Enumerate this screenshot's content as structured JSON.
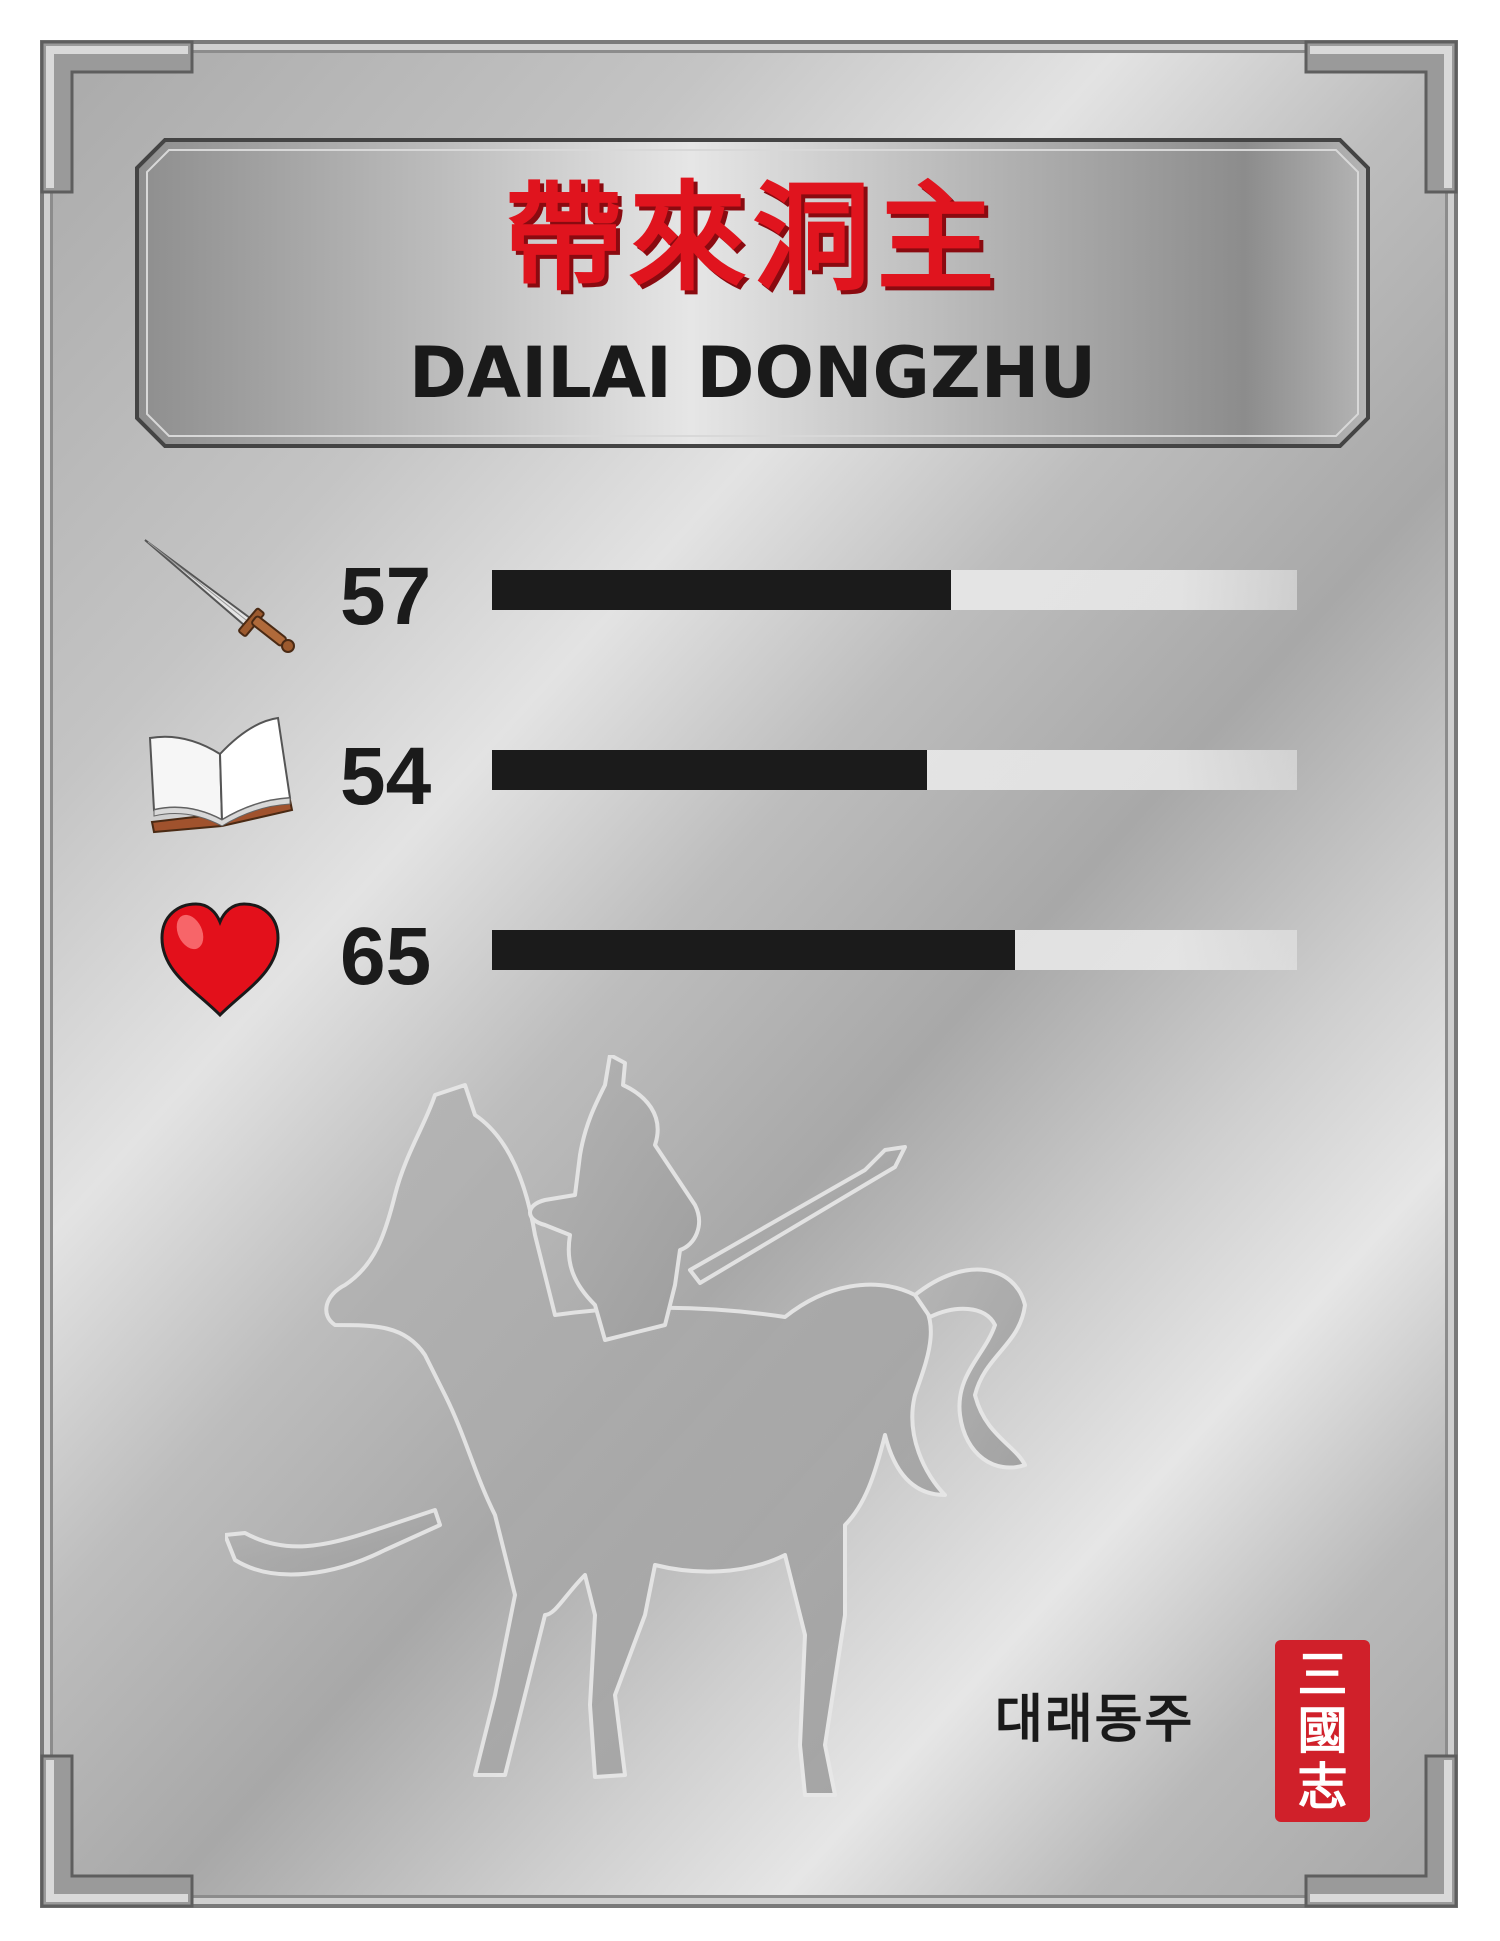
{
  "card": {
    "title_cn": "帶來洞主",
    "title_en": "DAILAI DONGZHU"
  },
  "stats": [
    {
      "icon": "sword-icon",
      "value": "57",
      "level": 57
    },
    {
      "icon": "book-icon",
      "value": "54",
      "level": 54
    },
    {
      "icon": "heart-icon",
      "value": "65",
      "level": 65
    }
  ],
  "stat_scale_max": 100,
  "footer": {
    "caption_kr": "대래동주",
    "seal_text": "三國志"
  },
  "colors": {
    "title_red": "#e0141e",
    "bar_fill": "#1b1b1b",
    "bar_track": "#e6e6e6",
    "seal_red": "#d0202a",
    "heart_red": "#e3101b"
  }
}
